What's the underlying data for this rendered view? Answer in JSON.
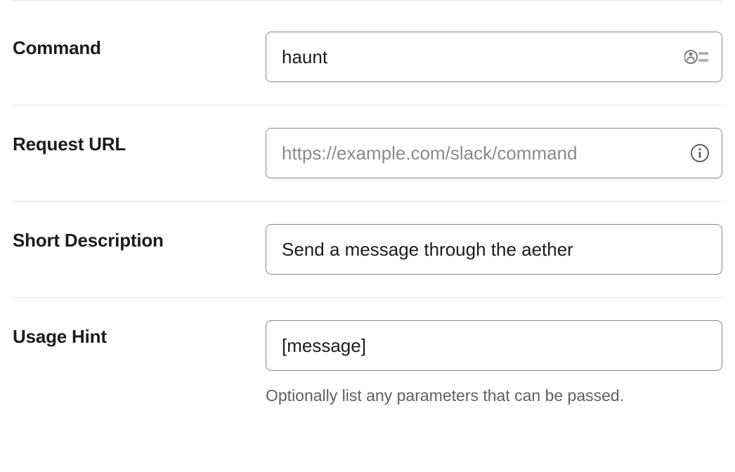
{
  "fields": {
    "command": {
      "label": "Command",
      "value": "haunt",
      "placeholder": ""
    },
    "request_url": {
      "label": "Request URL",
      "value": "",
      "placeholder": "https://example.com/slack/command"
    },
    "short_description": {
      "label": "Short Description",
      "value": "Send a message through the aether",
      "placeholder": ""
    },
    "usage_hint": {
      "label": "Usage Hint",
      "value": "[message]",
      "placeholder": "",
      "help": "Optionally list any parameters that can be passed."
    }
  }
}
